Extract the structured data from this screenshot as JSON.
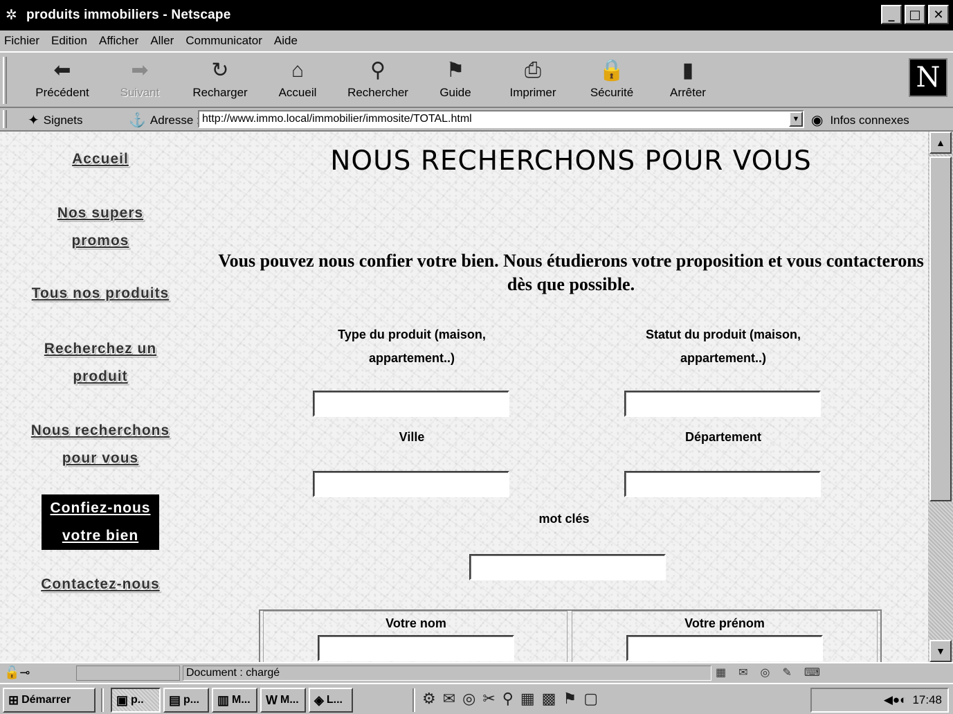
{
  "window": {
    "title": "produits immobiliers - Netscape",
    "buttons": [
      "_",
      "□",
      "✕"
    ]
  },
  "menu": [
    {
      "label": "Fichier"
    },
    {
      "label": "Edition"
    },
    {
      "label": "Afficher"
    },
    {
      "label": "Aller"
    },
    {
      "label": "Communicator"
    },
    {
      "label": "Aide"
    }
  ],
  "toolbar": {
    "buttons": [
      {
        "label": "Précédent",
        "icon": "back-arrow-icon",
        "enabled": true
      },
      {
        "label": "Suivant",
        "icon": "forward-arrow-icon",
        "enabled": false
      },
      {
        "label": "Recharger",
        "icon": "reload-icon",
        "enabled": true
      },
      {
        "label": "Accueil",
        "icon": "home-icon",
        "enabled": true
      },
      {
        "label": "Rechercher",
        "icon": "search-icon",
        "enabled": true
      },
      {
        "label": "Guide",
        "icon": "guide-icon",
        "enabled": true
      },
      {
        "label": "Imprimer",
        "icon": "printer-icon",
        "enabled": true
      },
      {
        "label": "Sécurité",
        "icon": "lock-icon",
        "enabled": true
      },
      {
        "label": "Arrêter",
        "icon": "stop-icon",
        "enabled": true
      }
    ],
    "logo": "N"
  },
  "location": {
    "bookmarks_label": "Signets",
    "address_label": "Adresse :",
    "url": "http://www.immo.local/immobilier/immosite/TOTAL.html",
    "related_label": "Infos connexes"
  },
  "nav": {
    "items": [
      {
        "label": "Accueil"
      },
      {
        "label": "Nos supers promos"
      },
      {
        "label": "Tous nos produits"
      },
      {
        "label": "Recherchez un produit"
      },
      {
        "label": "Nous recherchons pour vous"
      },
      {
        "label": "Confiez-nous votre bien",
        "active": true
      },
      {
        "label": "Contactez-nous"
      }
    ]
  },
  "page": {
    "heading": "NOUS RECHERCHONS POUR VOUS",
    "intro": "Vous pouvez nous confier votre bien. Nous étudierons votre proposition et vous contacterons dès que possible.",
    "fields": {
      "type_label": "Type du produit (maison, appartement..)",
      "statut_label": "Statut du produit (maison, appartement..)",
      "ville_label": "Ville",
      "departement_label": "Département",
      "motcles_label": "mot clés",
      "nom_label": "Votre nom",
      "prenom_label": "Votre prénom"
    }
  },
  "status": {
    "text": "Document : chargé"
  },
  "taskbar": {
    "start_label": "Démarrer",
    "tasks": [
      {
        "label": "p..",
        "pressed": true
      },
      {
        "label": "p...",
        "pressed": false
      },
      {
        "label": "M...",
        "pressed": false
      },
      {
        "label": "M...",
        "pressed": false
      },
      {
        "label": "L...",
        "pressed": false
      }
    ],
    "clock": "17:48"
  },
  "colors": {
    "titlebar": "#000000",
    "chrome": "#c0c0c0",
    "active_nav_bg": "#000000"
  }
}
